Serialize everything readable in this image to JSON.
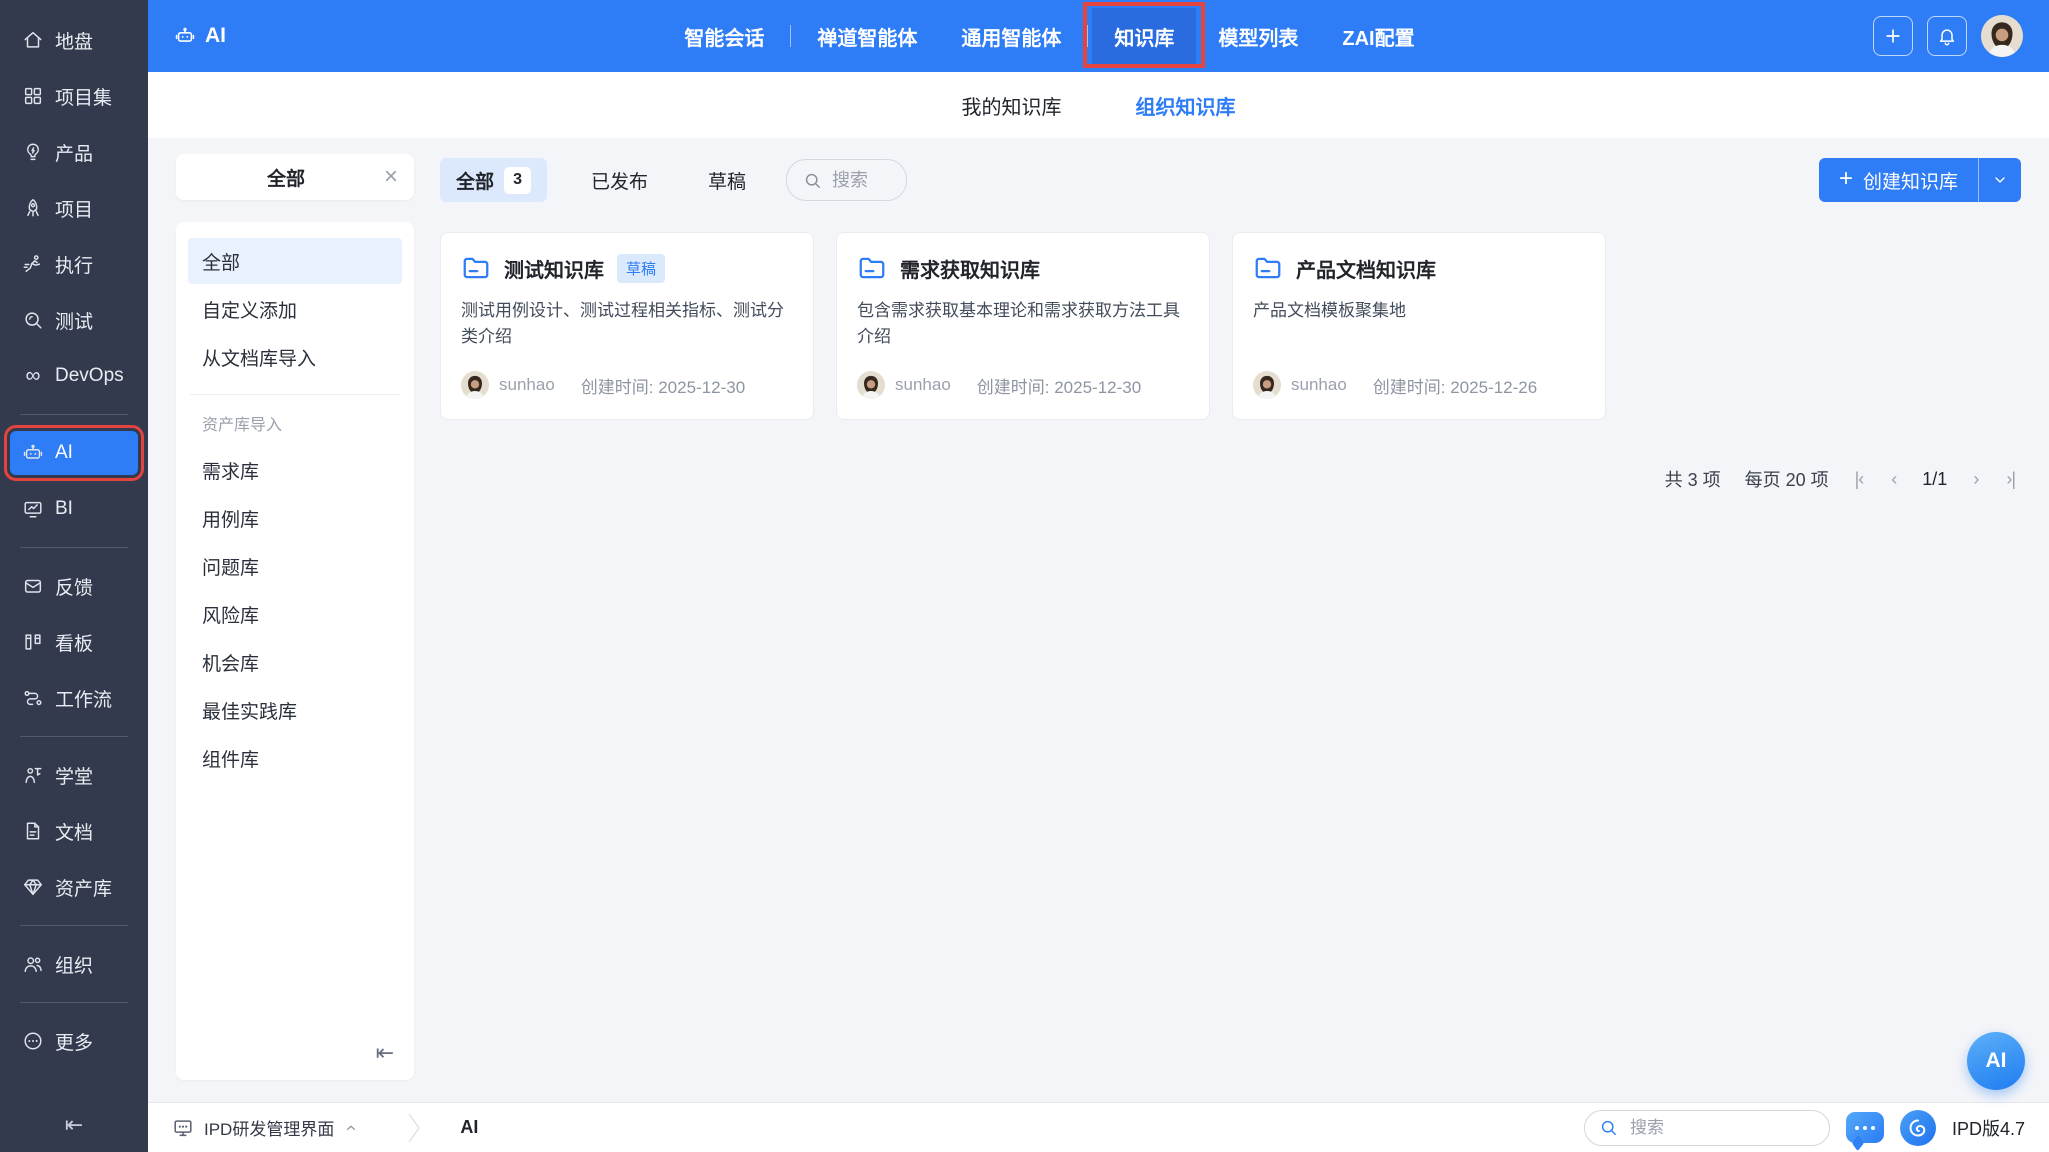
{
  "topbar": {
    "logo_label": "AI",
    "nav": [
      {
        "label": "智能会话",
        "sep_after": true
      },
      {
        "label": "禅道智能体"
      },
      {
        "label": "通用智能体",
        "sep_after": true
      },
      {
        "label": "知识库",
        "active": true,
        "annotated": true
      },
      {
        "label": "模型列表"
      },
      {
        "label": "ZAI配置"
      }
    ]
  },
  "sidebar": {
    "items": [
      {
        "label": "地盘",
        "icon": "home-icon"
      },
      {
        "label": "项目集",
        "icon": "grid-icon"
      },
      {
        "label": "产品",
        "icon": "lightbulb-icon"
      },
      {
        "label": "项目",
        "icon": "rocket-icon"
      },
      {
        "label": "执行",
        "icon": "runner-icon"
      },
      {
        "label": "测试",
        "icon": "magnifier-icon"
      },
      {
        "label": "DevOps",
        "icon": "infinity-icon"
      },
      {
        "label": "AI",
        "icon": "robot-icon",
        "active": true,
        "annotated": true,
        "divider_before": true
      },
      {
        "label": "BI",
        "icon": "chart-board-icon"
      },
      {
        "label": "反馈",
        "icon": "feedback-icon",
        "divider_before": true
      },
      {
        "label": "看板",
        "icon": "kanban-icon"
      },
      {
        "label": "工作流",
        "icon": "workflow-icon"
      },
      {
        "label": "学堂",
        "icon": "school-icon",
        "divider_before": true
      },
      {
        "label": "文档",
        "icon": "document-icon"
      },
      {
        "label": "资产库",
        "icon": "diamond-icon"
      },
      {
        "label": "组织",
        "icon": "people-icon",
        "divider_before": true
      },
      {
        "label": "更多",
        "icon": "more-icon",
        "divider_before": true
      }
    ],
    "collapse_icon": "collapse-left-icon"
  },
  "subnav": {
    "tabs": [
      {
        "label": "我的知识库"
      },
      {
        "label": "组织知识库",
        "active": true
      }
    ]
  },
  "filter": {
    "header": "全部",
    "items": [
      {
        "label": "全部",
        "active": true
      },
      {
        "label": "自定义添加"
      },
      {
        "label": "从文档库导入"
      }
    ],
    "group_label": "资产库导入",
    "group_items": [
      {
        "label": "需求库"
      },
      {
        "label": "用例库"
      },
      {
        "label": "问题库"
      },
      {
        "label": "风险库"
      },
      {
        "label": "机会库"
      },
      {
        "label": "最佳实践库"
      },
      {
        "label": "组件库"
      }
    ]
  },
  "toolbar": {
    "tabs": [
      {
        "label": "全部",
        "count": "3",
        "active": true
      },
      {
        "label": "已发布"
      },
      {
        "label": "草稿"
      }
    ],
    "search_placeholder": "搜索",
    "create_plus": "+",
    "create_label": "创建知识库"
  },
  "cards": [
    {
      "title": "测试知识库",
      "badge": "草稿",
      "description": "测试用例设计、测试过程相关指标、测试分类介绍",
      "owner": "sunhao",
      "created": "创建时间: 2025-12-30"
    },
    {
      "title": "需求获取知识库",
      "description": "包含需求获取基本理论和需求获取方法工具介绍",
      "owner": "sunhao",
      "created": "创建时间: 2025-12-30"
    },
    {
      "title": "产品文档知识库",
      "description": "产品文档模板聚集地",
      "owner": "sunhao",
      "created": "创建时间: 2025-12-26"
    }
  ],
  "pagination": {
    "total": "共 3 项",
    "per_page": "每页 20 项",
    "page": "1/1"
  },
  "bottombar": {
    "workspace": "IPD研发管理界面",
    "current": "AI",
    "search_placeholder": "搜索",
    "version": "IPD版4.7"
  },
  "floating_ai_label": "AI",
  "colors": {
    "accent": "#2E7CF6",
    "topnav_active_bg": "#2A6CE0",
    "annotation_red": "#E5433E",
    "sidebar_bg": "#333A4D",
    "page_bg": "#F4F5F8",
    "draft_badge_bg": "#DBE9FD",
    "tab_active_bg": "#DCE9FC"
  }
}
